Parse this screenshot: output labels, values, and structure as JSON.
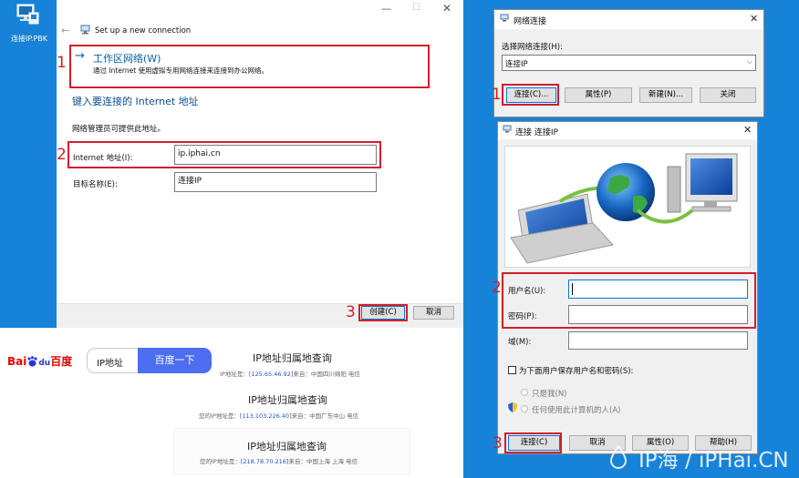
{
  "desktop": {
    "icon_label": "连接IP.PBK"
  },
  "wizard": {
    "title": "Set up a new connection",
    "option_title": "工作区网络(W)",
    "option_desc": "通过 Internet 使用虚拟专用网络连接来连接到办公网络。",
    "heading": "键入要连接的 Internet 地址",
    "note": "网络管理员可提供此地址。",
    "address_label": "Internet 地址(I):",
    "address_value": "ip.iphai.cn",
    "dest_label": "目标名称(E):",
    "dest_value": "连接IP",
    "create_label": "创建(C)",
    "cancel_label": "取消"
  },
  "network_dialog": {
    "title": "网络连接",
    "select_label": "选择网络连接(H):",
    "selected": "连接IP",
    "connect_label": "连接(C)...",
    "properties_label": "属性(P)",
    "new_label": "新建(N)...",
    "close_label": "关闭"
  },
  "connect_dialog": {
    "title": "连接 连接IP",
    "username_label": "用户名(U):",
    "password_label": "密码(P):",
    "domain_label": "域(M):",
    "save_label": "为下面用户保存用户名和密码(S):",
    "only_me_label": "只是我(N)",
    "anyone_label": "任何使用此计算机的人(A)",
    "connect_label": "连接(C)",
    "cancel_label": "取消",
    "properties_label": "属性(O)",
    "help_label": "帮助(H)"
  },
  "baidu": {
    "logo_prefix": "Bai",
    "logo_mid": "du",
    "logo_suffix": "百度",
    "search_value": "IP地址",
    "search_button": "百度一下",
    "results": [
      {
        "title": "IP地址归属地查询",
        "prefix": "IP地址是：",
        "ip": "[125.65.46.92]",
        "suffix": "来自：中国四川绵阳 电信"
      },
      {
        "title": "IP地址归属地查询",
        "prefix": "您的IP地址是：",
        "ip": "[113.103.226.40]",
        "suffix": "来自：中国广东中山 电信"
      },
      {
        "title": "IP地址归属地查询",
        "prefix": "您的IP地址是：",
        "ip": "[218.78.70.216]",
        "suffix": "来自：中国上海 上海 电信"
      }
    ]
  },
  "annotations": {
    "left_1": "1",
    "left_2": "2",
    "left_3": "3",
    "right_1": "1",
    "right_2": "2",
    "right_3": "3"
  },
  "watermark": "IP海 / iPHai.CN",
  "colors": {
    "desktop_blue": "#1683d8",
    "link_blue": "#0b5fa6",
    "annotation_red": "#d11e2b",
    "baidu_blue": "#4e6ef2",
    "baidu_red": "#e10602"
  }
}
